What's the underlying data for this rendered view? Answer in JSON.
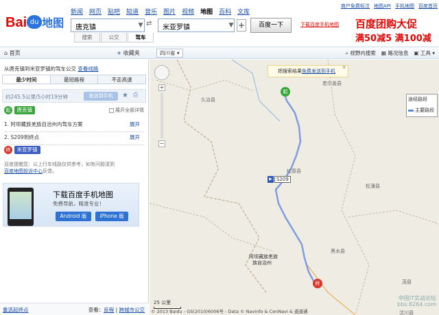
{
  "header": {
    "logo_text": "Bai",
    "logo_du": "du",
    "logo_cn": "地图",
    "nav": [
      "新闻",
      "网页",
      "贴吧",
      "知道",
      "音乐",
      "图片",
      "视频",
      "地图",
      "百科",
      "文库"
    ],
    "nav_current_index": 7,
    "top_links": [
      "商户免费标注",
      "地图API",
      "手机地图",
      "百度首页"
    ],
    "from_value": "唐克镇",
    "to_value": "米亚罗镇",
    "search_label": "百度一下",
    "download_link": "下载百度手机地图",
    "modes": [
      "搜索",
      "公交",
      "驾车"
    ],
    "mode_active_index": 2,
    "ad_line1": "百度团购大促",
    "ad_line2": "满50减5 满100减"
  },
  "toolbar": {
    "home": "首页",
    "fav": "收藏夹",
    "region": "四川省",
    "tools": [
      "视野内搜索",
      "路况信息",
      "工具"
    ]
  },
  "panel": {
    "route_title": "从唐克镇到米亚罗镇的驾车公交",
    "route_link": "查看线路",
    "tabs": [
      "最少时间",
      "最短路程",
      "不走高速"
    ],
    "tab_active_index": 0,
    "summary": "约245.5公里/5小时19分钟",
    "send_label": "发送到手机",
    "start_marker": "起",
    "start_name": "唐克镇",
    "expand_all": "展开全部详情",
    "steps": [
      {
        "text": "1. 阿坝藏族羌族自治州内驾车方案",
        "expand": "展开"
      },
      {
        "text": "2. S209到终点",
        "expand": "展开"
      }
    ],
    "end_marker": "终",
    "end_name": "米亚罗镇",
    "tip_text": "百度提醒您：以上行车线路仅供参考，如有问题请到",
    "tip_link": "百度地图投诉中心",
    "tip_suffix": "反馈。",
    "banner_title": "下载百度手机地图",
    "banner_sub": "免费导航，精准专业！",
    "android_label": "Android 版",
    "iphone_label": "iPhone 版",
    "reset": "重选起终点",
    "seealso_prefix": "查看：",
    "seealso_links": [
      "反程",
      "跨城市公交"
    ]
  },
  "map": {
    "notice_text": "把搜索结果",
    "notice_link": "免费发送到手机",
    "legend_title": "途经路段",
    "legend_item": "主要路段",
    "road_badge": "S209",
    "start_marker": "起",
    "end_marker": "终",
    "labels": [
      "久治县",
      "若尔盖县",
      "红原县",
      "松潘县",
      "黑水县",
      "阿坝藏族羌族",
      "族自治州",
      "茂县",
      "汶川县"
    ],
    "scale": "25 公里",
    "copyright": "© 2013 Baidu - GS(2010)6006号 - Data © Navinfo & CenNavi & 道道通",
    "watermark1": "中国IT实战论坛",
    "watermark2": "bbs.8264.com"
  }
}
